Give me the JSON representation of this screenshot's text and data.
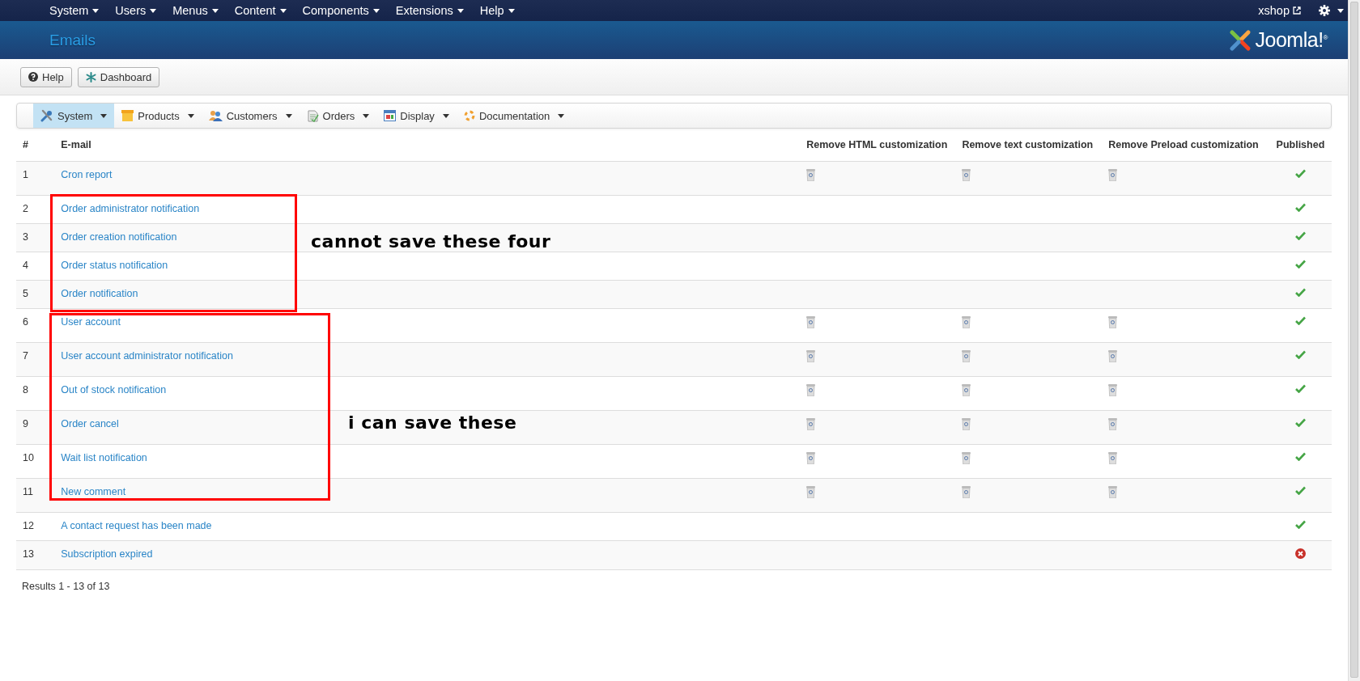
{
  "top_menu": {
    "items": [
      "System",
      "Users",
      "Menus",
      "Content",
      "Components",
      "Extensions",
      "Help"
    ],
    "site_link": "xshop"
  },
  "header": {
    "title": "Emails",
    "logo_text": "Joomla!$^{®}$"
  },
  "toolbar": {
    "buttons": [
      {
        "kind": "help",
        "label": "Help"
      },
      {
        "kind": "dashboard",
        "label": "Dashboard"
      }
    ]
  },
  "submenu": [
    {
      "kind": "system",
      "label": "System",
      "selected": true
    },
    {
      "kind": "products",
      "label": "Products",
      "selected": false
    },
    {
      "kind": "customers",
      "label": "Customers",
      "selected": false
    },
    {
      "kind": "orders",
      "label": "Orders",
      "selected": false
    },
    {
      "kind": "display",
      "label": "Display",
      "selected": false
    },
    {
      "kind": "documentation",
      "label": "Documentation",
      "selected": false
    }
  ],
  "table": {
    "columns": [
      "#",
      "E-mail",
      "Remove HTML customization",
      "Remove text customization",
      "Remove Preload customization",
      "Published"
    ],
    "rows": [
      {
        "number": "1",
        "email": "Cron report",
        "remove_html": true,
        "remove_text": true,
        "remove_preload": true,
        "published": true
      },
      {
        "number": "2",
        "email": "Order administrator notification",
        "remove_html": false,
        "remove_text": false,
        "remove_preload": false,
        "published": true
      },
      {
        "number": "3",
        "email": "Order creation notification",
        "remove_html": false,
        "remove_text": false,
        "remove_preload": false,
        "published": true
      },
      {
        "number": "4",
        "email": "Order status notification",
        "remove_html": false,
        "remove_text": false,
        "remove_preload": false,
        "published": true
      },
      {
        "number": "5",
        "email": "Order notification",
        "remove_html": false,
        "remove_text": false,
        "remove_preload": false,
        "published": true
      },
      {
        "number": "6",
        "email": "User account",
        "remove_html": true,
        "remove_text": true,
        "remove_preload": true,
        "published": true
      },
      {
        "number": "7",
        "email": "User account administrator notification",
        "remove_html": true,
        "remove_text": true,
        "remove_preload": true,
        "published": true
      },
      {
        "number": "8",
        "email": "Out of stock notification",
        "remove_html": true,
        "remove_text": true,
        "remove_preload": true,
        "published": true
      },
      {
        "number": "9",
        "email": "Order cancel",
        "remove_html": true,
        "remove_text": true,
        "remove_preload": true,
        "published": true
      },
      {
        "number": "10",
        "email": "Wait list notification",
        "remove_html": true,
        "remove_text": true,
        "remove_preload": true,
        "published": true
      },
      {
        "number": "11",
        "email": "New comment",
        "remove_html": true,
        "remove_text": true,
        "remove_preload": true,
        "published": true
      },
      {
        "number": "12",
        "email": "A contact request has been made",
        "remove_html": false,
        "remove_text": false,
        "remove_preload": false,
        "published": true
      },
      {
        "number": "13",
        "email": "Subscription expired",
        "remove_html": false,
        "remove_text": false,
        "remove_preload": false,
        "published": false
      }
    ],
    "results": "Results 1 - 13 of 13"
  },
  "annotations": [
    {
      "kind": "box-note",
      "text": "cannot save these four"
    },
    {
      "kind": "box-note",
      "text": "i can save these"
    }
  ]
}
